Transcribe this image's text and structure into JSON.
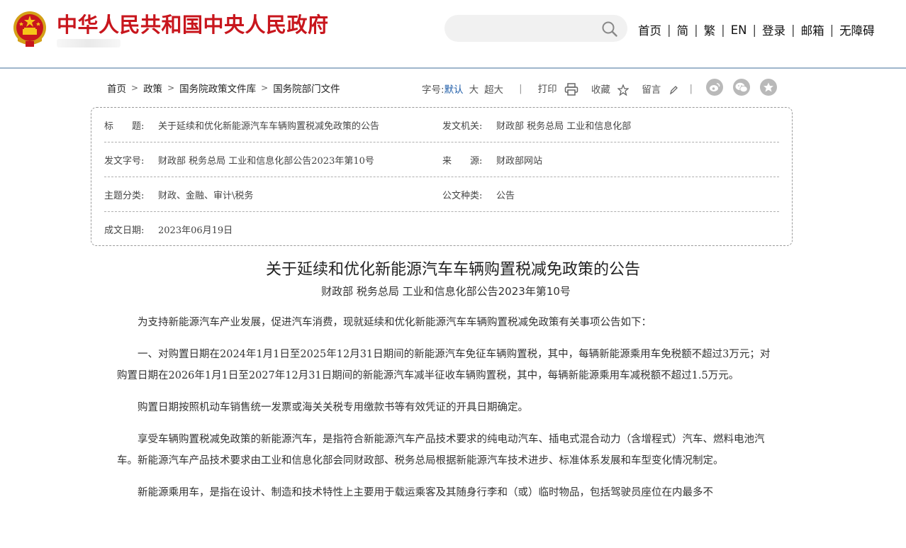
{
  "header": {
    "site_title": "中华人民共和国中央人民政府",
    "search": {
      "value": "",
      "placeholder": ""
    },
    "nav": [
      "首页",
      "简",
      "繁",
      "EN",
      "登录",
      "邮箱",
      "无障碍"
    ]
  },
  "breadcrumb": [
    "首页",
    "政策",
    "国务院政策文件库",
    "国务院部门文件"
  ],
  "tools": {
    "font_label": "字号:",
    "font_default": "默认",
    "font_large": "大",
    "font_xlarge": "超大",
    "print": "打印",
    "favorite": "收藏",
    "comment": "留言"
  },
  "share_icons": [
    "weibo-icon",
    "wechat-icon",
    "favorite-star-icon"
  ],
  "info": {
    "title_label": "标　　题:",
    "title_value": "关于延续和优化新能源汽车车辆购置税减免政策的公告",
    "issuer_label": "发文机关:",
    "issuer_value": "财政部 税务总局 工业和信息化部",
    "doc_no_label": "发文字号:",
    "doc_no_value": "财政部 税务总局 工业和信息化部公告2023年第10号",
    "source_label": "来　　源:",
    "source_value": "财政部网站",
    "category_label": "主题分类:",
    "category_value": "财政、金融、审计\\税务",
    "doc_type_label": "公文种类:",
    "doc_type_value": "公告",
    "date_label": "成文日期:",
    "date_value": "2023年06月19日"
  },
  "article": {
    "title": "关于延续和优化新能源汽车车辆购置税减免政策的公告",
    "subtitle": "财政部 税务总局 工业和信息化部公告2023年第10号",
    "paragraphs": [
      "为支持新能源汽车产业发展，促进汽车消费，现就延续和优化新能源汽车车辆购置税减免政策有关事项公告如下：",
      "一、对购置日期在2024年1月1日至2025年12月31日期间的新能源汽车免征车辆购置税，其中，每辆新能源乘用车免税额不超过3万元；对购置日期在2026年1月1日至2027年12月31日期间的新能源汽车减半征收车辆购置税，其中，每辆新能源乘用车减税额不超过1.5万元。",
      "购置日期按照机动车销售统一发票或海关关税专用缴款书等有效凭证的开具日期确定。",
      "享受车辆购置税减免政策的新能源汽车，是指符合新能源汽车产品技术要求的纯电动汽车、插电式混合动力（含增程式）汽车、燃料电池汽车。新能源汽车产品技术要求由工业和信息化部会同财政部、税务总局根据新能源汽车技术进步、标准体系发展和车型变化情况制定。",
      "新能源乘用车，是指在设计、制造和技术特性上主要用于载运乘客及其随身行李和（或）临时物品，包括驾驶员座位在内最多不"
    ]
  },
  "colors": {
    "brand_red": "#c8161d",
    "accent_blue": "#1f5da8",
    "header_line": "#9fb6cc"
  }
}
